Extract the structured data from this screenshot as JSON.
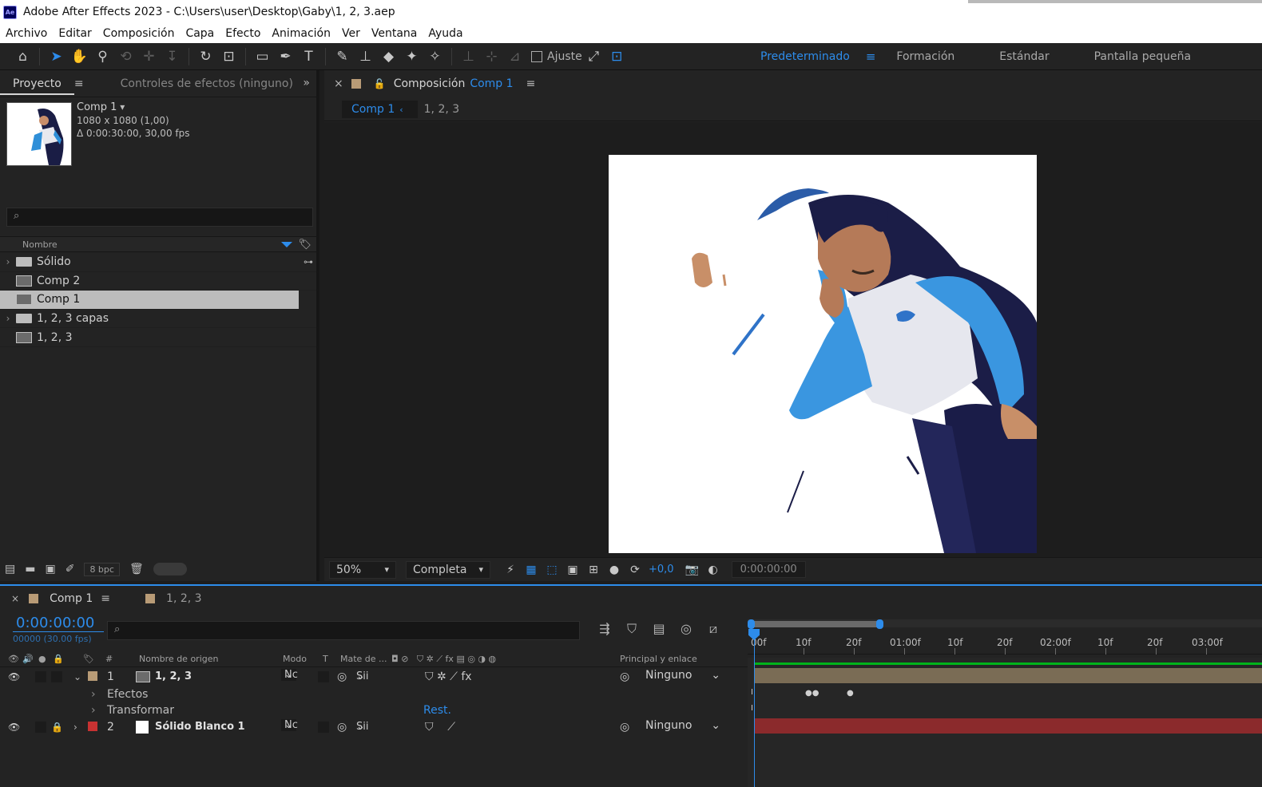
{
  "app": {
    "title": "Adobe After Effects 2023 - C:\\Users\\user\\Desktop\\Gaby\\1, 2, 3.aep",
    "logo": "Ae",
    "accent": "#2d8ceb"
  },
  "menu": [
    "Archivo",
    "Editar",
    "Composición",
    "Capa",
    "Efecto",
    "Animación",
    "Ver",
    "Ventana",
    "Ayuda"
  ],
  "toolbar": {
    "snap_label": "Ajuste",
    "workspaces": [
      "Predeterminado",
      "Formación",
      "Estándar",
      "Pantalla pequeña"
    ],
    "workspace_menu": "≡"
  },
  "project": {
    "tab_active": "Proyecto",
    "tab_menu": "≡",
    "tab_other": "Controles de efectos (ninguno)",
    "expand_icon": "»",
    "selected_name": "Comp 1",
    "dims": "1080 x 1080 (1,00)",
    "duration": "Δ 0:00:30:00, 30,00 fps",
    "search_icon": "⌕",
    "column_name": "Nombre",
    "items": [
      {
        "name": "Sólido",
        "type": "folder",
        "expandable": true
      },
      {
        "name": "Comp 2",
        "type": "comp",
        "expandable": false
      },
      {
        "name": "Comp 1",
        "type": "comp",
        "expandable": false,
        "selected": true
      },
      {
        "name": "1, 2, 3 capas",
        "type": "folder",
        "expandable": true
      },
      {
        "name": "1, 2, 3",
        "type": "comp",
        "expandable": false
      }
    ],
    "bpc": "8 bpc"
  },
  "composition": {
    "tab_label": "Composición",
    "tab_comp": "Comp 1",
    "tab_menu": "≡",
    "breadcrumb_active": "Comp 1",
    "breadcrumb_next": "1, 2, 3",
    "zoom": "50%",
    "resolution": "Completa",
    "exposure": "+0,0",
    "timecode": "0:00:00:00"
  },
  "timeline": {
    "tab_active": "Comp 1",
    "tab_menu": "≡",
    "tab_other": "1, 2, 3",
    "timecode": "0:00:00:00",
    "frames": "00000 (30.00 fps)",
    "columns": {
      "num": "#",
      "source": "Nombre de origen",
      "mode": "Modo",
      "t": "T",
      "matte": "Mate de ...",
      "parent": "Principal y enlace"
    },
    "layers": [
      {
        "num": "1",
        "name": "1, 2, 3",
        "mode": "Nc",
        "matte": "Sii",
        "parent": "Ninguno",
        "label_color": "#b89b76",
        "bar_color": "#7a6c55"
      },
      {
        "num": "2",
        "name": "Sólido Blanco 1",
        "mode": "Nc",
        "matte": "Sii",
        "parent": "Ninguno",
        "label_color": "#c83232",
        "bar_color": "#8b2a2c"
      }
    ],
    "sub": {
      "effects": "Efectos",
      "transform": "Transformar",
      "reset": "Rest."
    },
    "ruler": [
      "00f",
      "10f",
      "20f",
      "01:00f",
      "10f",
      "20f",
      "02:00f",
      "10f",
      "20f",
      "03:00f"
    ]
  }
}
